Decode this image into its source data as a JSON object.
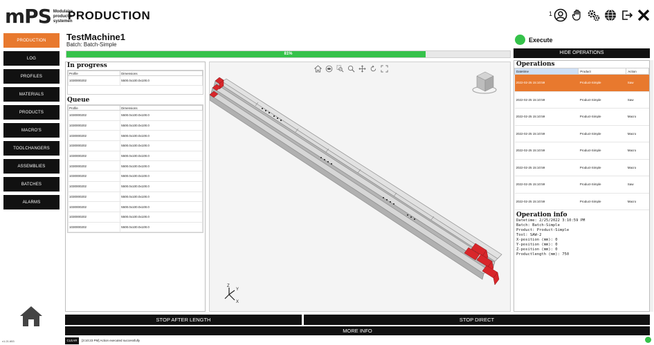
{
  "header": {
    "logo_text": "mPS",
    "logo_sub": [
      "Modulaire",
      "productie",
      "systemen"
    ],
    "title": "PRODUCTION",
    "user_count": "1",
    "icons": [
      "user-icon",
      "hand-icon",
      "gears-icon",
      "globe-icon",
      "logout-icon",
      "close-icon"
    ]
  },
  "sidebar": {
    "items": [
      {
        "label": "PRODUCTION",
        "active": true
      },
      {
        "label": "LOG"
      },
      {
        "label": "PROFILES"
      },
      {
        "label": "MATERIALS"
      },
      {
        "label": "PRODUCTS"
      },
      {
        "label": "MACRO'S"
      },
      {
        "label": "TOOLCHANGERS"
      },
      {
        "label": "ASSEMBLIES"
      },
      {
        "label": "BATCHES"
      },
      {
        "label": "ALARMS"
      }
    ],
    "home_icon": "home-icon",
    "version": "v1.21.653"
  },
  "machine": {
    "name": "TestMachine1",
    "batch": "Batch: Batch-Simple",
    "progress_label": "81%",
    "progress_fraction": 0.81
  },
  "execute": {
    "label": "Execute",
    "color": "#35c24a"
  },
  "hide_operations_label": "HIDE OPERATIONS",
  "in_progress": {
    "title": "In progress",
    "columns": [
      "Profile",
      "Dimensions"
    ],
    "rows": [
      [
        "1030000202",
        "5500.0x100.0x100.0"
      ]
    ]
  },
  "queue": {
    "title": "Queue",
    "columns": [
      "Profile",
      "Dimensions"
    ],
    "rows": [
      [
        "1030000202",
        "5500.0x100.0x100.0"
      ],
      [
        "1030000202",
        "5500.0x100.0x100.0"
      ],
      [
        "1030000202",
        "5500.0x100.0x100.0"
      ],
      [
        "1030000202",
        "5500.0x100.0x100.0"
      ],
      [
        "1030000202",
        "5500.0x100.0x100.0"
      ],
      [
        "1030000202",
        "5500.0x100.0x100.0"
      ],
      [
        "1030000202",
        "5500.0x100.0x100.0"
      ],
      [
        "1030000202",
        "5500.0x100.0x100.0"
      ],
      [
        "1030000202",
        "5500.0x100.0x100.0"
      ],
      [
        "1030000202",
        "5500.0x100.0x100.0"
      ],
      [
        "1030000202",
        "5500.0x100.0x100.0"
      ],
      [
        "1030000202",
        "5500.0x100.0x100.0"
      ]
    ]
  },
  "viewer": {
    "tools": [
      "home-view-icon",
      "eye-icon",
      "zoom-region-icon",
      "zoom-icon",
      "pan-icon",
      "rotate-icon",
      "fit-icon"
    ],
    "axis": {
      "x": "X",
      "y": "Y",
      "z": "Z"
    }
  },
  "operations": {
    "title": "Operations",
    "columns": [
      "Datetime",
      "Product",
      "Action"
    ],
    "rows": [
      {
        "datetime": "2022-02-25 15:10:59",
        "product": "Product-Simple",
        "action": "Saw",
        "selected": true
      },
      {
        "datetime": "2022-02-25 15:10:59",
        "product": "Product-Simple",
        "action": "Saw"
      },
      {
        "datetime": "2022-02-25 15:10:59",
        "product": "Product-Simple",
        "action": "Macro"
      },
      {
        "datetime": "2022-02-25 15:10:59",
        "product": "Product-Simple",
        "action": "Macro"
      },
      {
        "datetime": "2022-02-25 15:10:59",
        "product": "Product-Simple",
        "action": "Macro"
      },
      {
        "datetime": "2022-02-25 15:10:59",
        "product": "Product-Simple",
        "action": "Macro"
      },
      {
        "datetime": "2022-02-25 15:10:59",
        "product": "Product-Simple",
        "action": "Saw"
      },
      {
        "datetime": "2022-02-25 15:10:59",
        "product": "Product-Simple",
        "action": "Macro"
      }
    ],
    "selected_color": "#e8792e"
  },
  "operation_info": {
    "title": "Operation info",
    "lines": [
      "Datetime: 2/25/2022 3:10:59 PM",
      "Batch: Batch-Simple",
      "Product: Product-Simple",
      "Tool: SAW-2",
      "X-position (mm): 0",
      "Y-position (mm): 0",
      "Z-position (mm): 0",
      "Productlength (mm): 750"
    ]
  },
  "bottom": {
    "stop_after_length": "STOP AFTER LENGTH",
    "stop_direct": "STOP DIRECT",
    "more_info": "MORE INFO",
    "clear": "CLEAR",
    "log_message": "[3:10:23 PM] Action executed successfully"
  },
  "colors": {
    "accent": "#e8792e",
    "success": "#35c24a",
    "dark": "#111111",
    "beam_end": "#d8262a"
  }
}
